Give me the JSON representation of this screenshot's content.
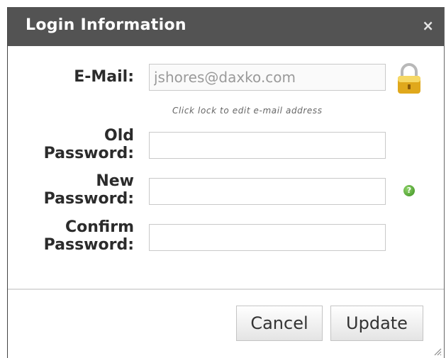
{
  "dialog": {
    "title": "Login Information",
    "close_glyph": "×"
  },
  "form": {
    "email_label": "E-Mail:",
    "email_value": "jshores@daxko.com",
    "lock_icon": "padlock-icon",
    "lock_hint": "Click lock to edit e-mail address",
    "old_password_label_1": "Old",
    "old_password_label_2": "Password:",
    "new_password_label_1": "New",
    "new_password_label_2": "Password:",
    "confirm_password_label_1": "Confirm",
    "confirm_password_label_2": "Password:",
    "help_glyph": "?",
    "help_icon": "help-icon"
  },
  "buttons": {
    "cancel": "Cancel",
    "update": "Update"
  },
  "colors": {
    "titlebar": "#535353",
    "help_green": "#3a8f1f",
    "lock_gold": "#e0a81c"
  }
}
